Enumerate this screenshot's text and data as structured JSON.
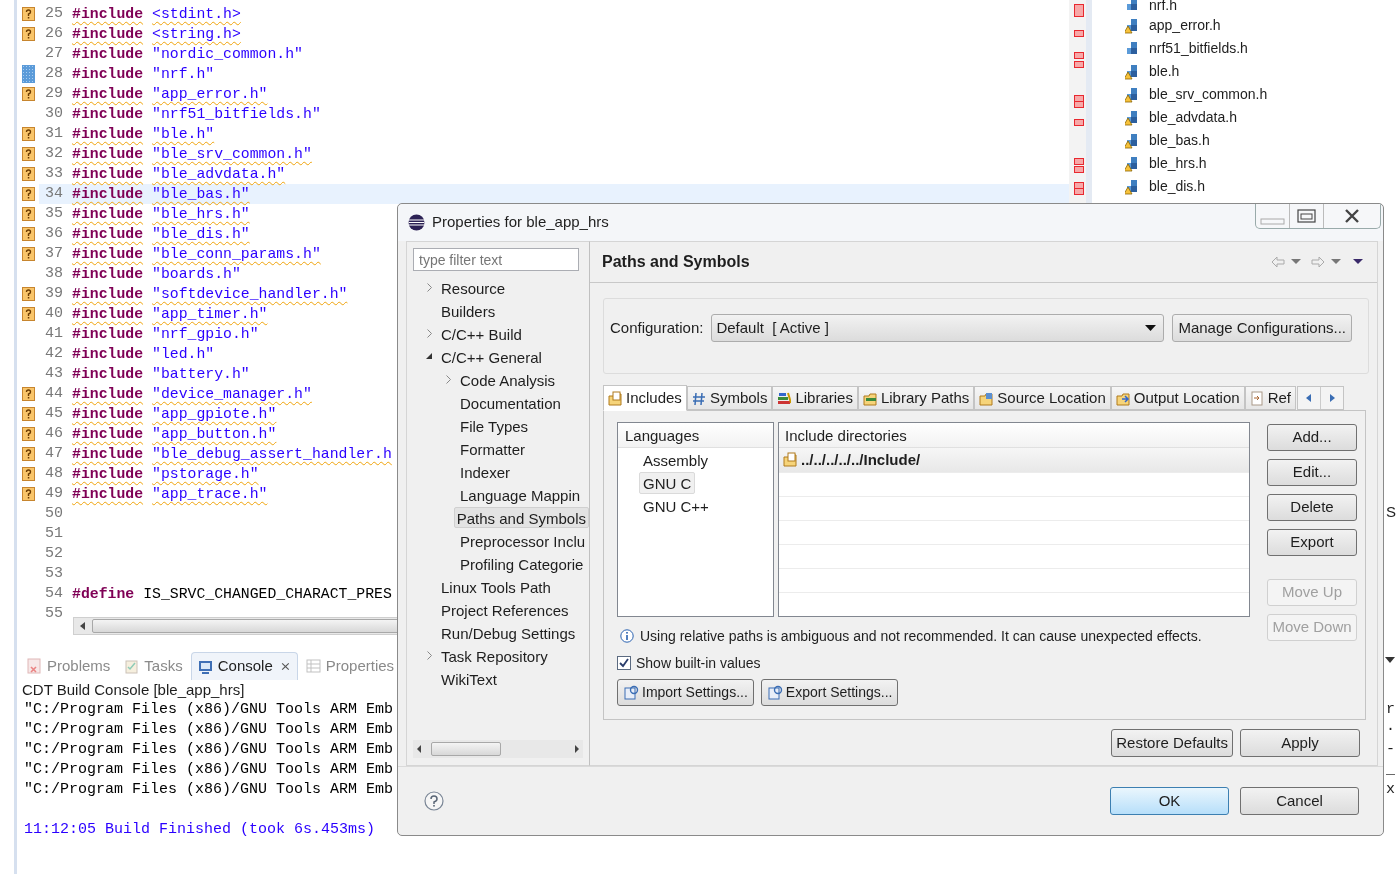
{
  "editor": {
    "lines": [
      {
        "number": "25",
        "kind": "include",
        "directive": "#include",
        "argument": "<stdint.h>",
        "warning": true,
        "occurrence": false,
        "current": false
      },
      {
        "number": "26",
        "kind": "include",
        "directive": "#include",
        "argument": "<string.h>",
        "warning": true,
        "occurrence": false,
        "current": false
      },
      {
        "number": "27",
        "kind": "include",
        "directive": "#include",
        "argument": "\"nordic_common.h\"",
        "warning": false,
        "occurrence": false,
        "current": false
      },
      {
        "number": "28",
        "kind": "include",
        "directive": "#include",
        "argument": "\"nrf.h\"",
        "warning": false,
        "occurrence": true,
        "current": false
      },
      {
        "number": "29",
        "kind": "include",
        "directive": "#include",
        "argument": "\"app_error.h\"",
        "warning": true,
        "occurrence": false,
        "current": false
      },
      {
        "number": "30",
        "kind": "include",
        "directive": "#include",
        "argument": "\"nrf51_bitfields.h\"",
        "warning": false,
        "occurrence": false,
        "current": false
      },
      {
        "number": "31",
        "kind": "include",
        "directive": "#include",
        "argument": "\"ble.h\"",
        "warning": true,
        "occurrence": false,
        "current": false
      },
      {
        "number": "32",
        "kind": "include",
        "directive": "#include",
        "argument": "\"ble_srv_common.h\"",
        "warning": true,
        "occurrence": false,
        "current": false
      },
      {
        "number": "33",
        "kind": "include",
        "directive": "#include",
        "argument": "\"ble_advdata.h\"",
        "warning": true,
        "occurrence": false,
        "current": false
      },
      {
        "number": "34",
        "kind": "include",
        "directive": "#include",
        "argument": "\"ble_bas.h\"",
        "warning": true,
        "occurrence": false,
        "current": true
      },
      {
        "number": "35",
        "kind": "include",
        "directive": "#include",
        "argument": "\"ble_hrs.h\"",
        "warning": true,
        "occurrence": false,
        "current": false
      },
      {
        "number": "36",
        "kind": "include",
        "directive": "#include",
        "argument": "\"ble_dis.h\"",
        "warning": true,
        "occurrence": false,
        "current": false
      },
      {
        "number": "37",
        "kind": "include",
        "directive": "#include",
        "argument": "\"ble_conn_params.h\"",
        "warning": true,
        "occurrence": false,
        "current": false
      },
      {
        "number": "38",
        "kind": "include",
        "directive": "#include",
        "argument": "\"boards.h\"",
        "warning": false,
        "occurrence": false,
        "current": false
      },
      {
        "number": "39",
        "kind": "include",
        "directive": "#include",
        "argument": "\"softdevice_handler.h\"",
        "warning": true,
        "occurrence": false,
        "current": false
      },
      {
        "number": "40",
        "kind": "include",
        "directive": "#include",
        "argument": "\"app_timer.h\"",
        "warning": true,
        "occurrence": false,
        "current": false
      },
      {
        "number": "41",
        "kind": "include",
        "directive": "#include",
        "argument": "\"nrf_gpio.h\"",
        "warning": false,
        "occurrence": false,
        "current": false
      },
      {
        "number": "42",
        "kind": "include",
        "directive": "#include",
        "argument": "\"led.h\"",
        "warning": false,
        "occurrence": false,
        "current": false
      },
      {
        "number": "43",
        "kind": "include",
        "directive": "#include",
        "argument": "\"battery.h\"",
        "warning": false,
        "occurrence": false,
        "current": false
      },
      {
        "number": "44",
        "kind": "include",
        "directive": "#include",
        "argument": "\"device_manager.h\"",
        "warning": true,
        "occurrence": false,
        "current": false
      },
      {
        "number": "45",
        "kind": "include",
        "directive": "#include",
        "argument": "\"app_gpiote.h\"",
        "warning": true,
        "occurrence": false,
        "current": false
      },
      {
        "number": "46",
        "kind": "include",
        "directive": "#include",
        "argument": "\"app_button.h\"",
        "warning": true,
        "occurrence": false,
        "current": false
      },
      {
        "number": "47",
        "kind": "include",
        "directive": "#include",
        "argument": "\"ble_debug_assert_handler.h",
        "warning": true,
        "occurrence": false,
        "current": false
      },
      {
        "number": "48",
        "kind": "include",
        "directive": "#include",
        "argument": "\"pstorage.h\"",
        "warning": true,
        "occurrence": false,
        "current": false
      },
      {
        "number": "49",
        "kind": "include",
        "directive": "#include",
        "argument": "\"app_trace.h\"",
        "warning": true,
        "occurrence": false,
        "current": false
      },
      {
        "number": "50",
        "kind": "blank",
        "warning": false,
        "occurrence": false,
        "current": false
      },
      {
        "number": "51",
        "kind": "blank",
        "warning": false,
        "occurrence": false,
        "current": false
      },
      {
        "number": "52",
        "kind": "blank",
        "warning": false,
        "occurrence": false,
        "current": false
      },
      {
        "number": "53",
        "kind": "blank",
        "warning": false,
        "occurrence": false,
        "current": false
      },
      {
        "number": "54",
        "kind": "define",
        "directive": "#define",
        "argument": "IS_SRVC_CHANGED_CHARACT_PRES",
        "warning": false,
        "occurrence": false,
        "current": false
      },
      {
        "number": "55",
        "kind": "blank",
        "warning": false,
        "occurrence": false,
        "current": false
      }
    ]
  },
  "outline": {
    "items": [
      {
        "label": "nrf.h",
        "warning": false
      },
      {
        "label": "app_error.h",
        "warning": true
      },
      {
        "label": "nrf51_bitfields.h",
        "warning": false
      },
      {
        "label": "ble.h",
        "warning": true
      },
      {
        "label": "ble_srv_common.h",
        "warning": true
      },
      {
        "label": "ble_advdata.h",
        "warning": true
      },
      {
        "label": "ble_bas.h",
        "warning": true
      },
      {
        "label": "ble_hrs.h",
        "warning": true
      },
      {
        "label": "ble_dis.h",
        "warning": true
      }
    ]
  },
  "bottom_panel": {
    "tabs": [
      {
        "label": "Problems",
        "selected": false
      },
      {
        "label": "Tasks",
        "selected": false
      },
      {
        "label": "Console",
        "selected": true,
        "close": "⨯"
      },
      {
        "label": "Properties",
        "selected": false
      }
    ],
    "console_title": "CDT Build Console [ble_app_hrs]",
    "console_lines": [
      "\"C:/Program Files (x86)/GNU Tools ARM Emb",
      "\"C:/Program Files (x86)/GNU Tools ARM Emb",
      "\"C:/Program Files (x86)/GNU Tools ARM Emb",
      "\"C:/Program Files (x86)/GNU Tools ARM Emb",
      "\"C:/Program Files (x86)/GNU Tools ARM Emb"
    ],
    "console_status": "11:12:05 Build Finished (took 6s.453ms)"
  },
  "right_edge_fragments": {
    "upper": "S",
    "console": [
      "r",
      "·",
      "-",
      "_",
      "x"
    ]
  },
  "dialog": {
    "title": "Properties for ble_app_hrs",
    "filter": {
      "placeholder": "type filter text"
    },
    "tree": [
      {
        "label": "Resource",
        "expanded": false,
        "selected": false
      },
      {
        "label": "Builders",
        "selected": false
      },
      {
        "label": "C/C++ Build",
        "expanded": false,
        "selected": false
      },
      {
        "label": "C/C++ General",
        "expanded": true,
        "selected": false,
        "children": [
          {
            "label": "Code Analysis",
            "expanded": false,
            "selected": false
          },
          {
            "label": "Documentation",
            "selected": false
          },
          {
            "label": "File Types",
            "selected": false
          },
          {
            "label": "Formatter",
            "selected": false
          },
          {
            "label": "Indexer",
            "selected": false
          },
          {
            "label": "Language Mappin",
            "selected": false
          },
          {
            "label": "Paths and Symbols",
            "selected": true
          },
          {
            "label": "Preprocessor Inclu",
            "selected": false
          },
          {
            "label": "Profiling Categorie",
            "selected": false
          }
        ]
      },
      {
        "label": "Linux Tools Path",
        "selected": false
      },
      {
        "label": "Project References",
        "selected": false
      },
      {
        "label": "Run/Debug Settings",
        "selected": false
      },
      {
        "label": "Task Repository",
        "expanded": false,
        "selected": false
      },
      {
        "label": "WikiText",
        "selected": false
      }
    ],
    "page_title": "Paths and Symbols",
    "configuration": {
      "label": "Configuration:",
      "value": "Default  [ Active ]",
      "button": "Manage Configurations..."
    },
    "tabs": [
      {
        "label": "Includes",
        "selected": true
      },
      {
        "label": "Symbols",
        "selected": false
      },
      {
        "label": "Libraries",
        "selected": false
      },
      {
        "label": "Library Paths",
        "selected": false
      },
      {
        "label": "Source Location",
        "selected": false
      },
      {
        "label": "Output Location",
        "selected": false
      },
      {
        "label": "Ref",
        "selected": false
      }
    ],
    "languages": {
      "heading": "Languages",
      "items": [
        {
          "label": "Assembly",
          "selected": false
        },
        {
          "label": "GNU C",
          "selected": true
        },
        {
          "label": "GNU C++",
          "selected": false
        }
      ]
    },
    "include_directories": {
      "heading": "Include directories",
      "items": [
        {
          "label": "../../../../../Include/",
          "selected": true
        }
      ]
    },
    "side_buttons": [
      {
        "label": "Add...",
        "disabled": false
      },
      {
        "label": "Edit...",
        "disabled": false
      },
      {
        "label": "Delete",
        "disabled": false
      },
      {
        "label": "Export",
        "disabled": false
      },
      {
        "label": "Move Up",
        "disabled": true
      },
      {
        "label": "Move Down",
        "disabled": true
      }
    ],
    "info": "Using relative paths is ambiguous and not recommended. It can cause unexpected effects.",
    "show_builtin": {
      "label": "Show built-in values",
      "checked": true
    },
    "settings_buttons": [
      "Import Settings...",
      "Export Settings..."
    ],
    "page_buttons": [
      "Restore Defaults",
      "Apply"
    ],
    "footer_buttons": [
      {
        "label": "OK",
        "default": true
      },
      {
        "label": "Cancel",
        "default": false
      }
    ]
  }
}
